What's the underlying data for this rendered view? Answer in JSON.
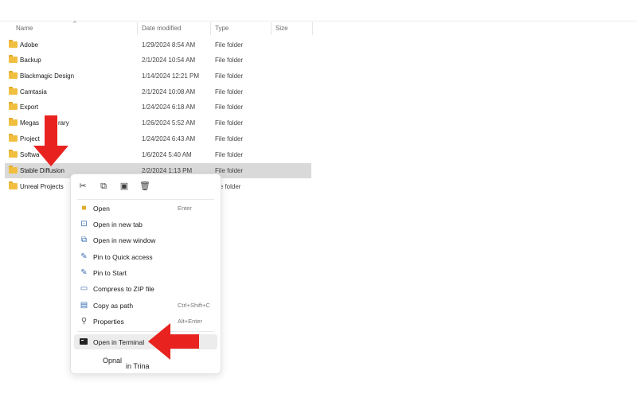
{
  "columns": {
    "name": "Name",
    "date_modified": "Date modified",
    "type": "Type",
    "size": "Size",
    "sort_indicator": "^"
  },
  "files": [
    {
      "name": "Adobe",
      "date": "1/29/2024 8:54 AM",
      "type": "File folder"
    },
    {
      "name": "Backup",
      "date": "2/1/2024 10:54 AM",
      "type": "File folder"
    },
    {
      "name": "Blackmagic Design",
      "date": "1/14/2024 12:21 PM",
      "type": "File folder"
    },
    {
      "name": "Camtasia",
      "date": "2/1/2024 10:08 AM",
      "type": "File folder"
    },
    {
      "name": "Export",
      "date": "1/24/2024 6:18 AM",
      "type": "File folder"
    },
    {
      "name": "Megascans Library",
      "name_visible": "Megas",
      "name_visible_2": "rary",
      "date": "1/26/2024 5:52 AM",
      "type": "File folder"
    },
    {
      "name": "Projects",
      "name_visible": "Project",
      "date": "1/24/2024 6:43 AM",
      "type": "File folder"
    },
    {
      "name": "Software",
      "name_visible": "Softwa",
      "date": "1/6/2024 5:40 AM",
      "type": "File folder"
    },
    {
      "name": "Stable Diffusion",
      "date": "2/2/2024 1:13 PM",
      "type": "File folder",
      "selected": true
    },
    {
      "name": "Unreal Projects",
      "date": "",
      "type": "File folder",
      "type_visible": "le folder"
    }
  ],
  "context_menu": {
    "quick_actions": [
      {
        "icon": "cut-icon",
        "glyph": "✂"
      },
      {
        "icon": "copy-icon",
        "glyph": "⧉"
      },
      {
        "icon": "rename-icon",
        "glyph": "▣"
      },
      {
        "icon": "delete-icon",
        "glyph": "🗑"
      }
    ],
    "items": [
      {
        "label": "Open",
        "shortcut": "Enter",
        "icon": "folder-open-icon"
      },
      {
        "label": "Open in new tab",
        "shortcut": "",
        "icon": "new-tab-icon"
      },
      {
        "label": "Open in new window",
        "shortcut": "",
        "icon": "new-window-icon"
      },
      {
        "label": "Pin to Quick access",
        "shortcut": "",
        "icon": "pin-icon"
      },
      {
        "label": "Pin to Start",
        "shortcut": "",
        "icon": "pin-icon"
      },
      {
        "label": "Compress to ZIP file",
        "shortcut": "",
        "icon": "zip-icon"
      },
      {
        "label": "Copy as path",
        "shortcut": "Ctrl+Shift+C",
        "icon": "copy-path-icon"
      },
      {
        "label": "Properties",
        "shortcut": "Alt+Enter",
        "icon": "properties-icon"
      },
      {
        "label": "Open in Terminal",
        "shortcut": "",
        "icon": "terminal-icon",
        "highlighted": true
      }
    ],
    "ghost_text_1": "Opnal",
    "ghost_text_2": "in Trina"
  },
  "colors": {
    "arrow": "#e8231f",
    "folder": "#f1bf40",
    "selection": "#d9d9d9",
    "hover": "#ececec"
  }
}
